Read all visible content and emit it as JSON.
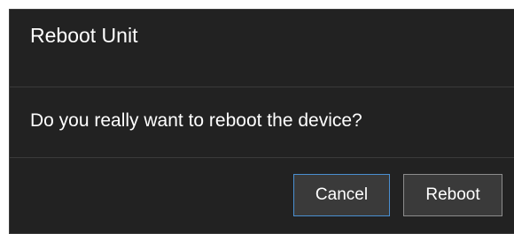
{
  "dialog": {
    "title": "Reboot Unit",
    "message": "Do you really want to reboot the device?",
    "buttons": {
      "cancel_label": "Cancel",
      "reboot_label": "Reboot"
    }
  },
  "colors": {
    "dialog_background": "#222222",
    "text": "#ffffff",
    "button_background": "#3a3a3a",
    "focus_border": "#4a8fd1",
    "button_border": "#8c8c8c",
    "divider": "#3a3a3a"
  }
}
